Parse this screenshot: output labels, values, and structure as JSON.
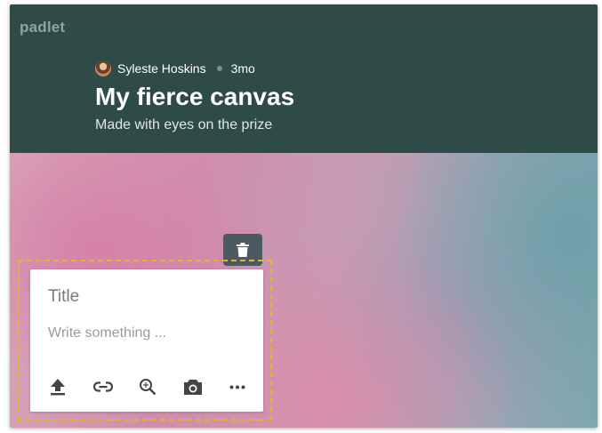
{
  "header": {
    "logo": "padlet",
    "author": "Syleste Hoskins",
    "age": "3mo",
    "title": "My fierce canvas",
    "subtitle": "Made with eyes on the prize"
  },
  "post_card": {
    "title_placeholder": "Title",
    "body_placeholder": "Write something ..."
  },
  "icons": {
    "trash": "trash-icon",
    "upload": "upload-icon",
    "link": "link-icon",
    "search": "image-search-icon",
    "camera": "camera-icon",
    "more": "more-icon"
  },
  "colors": {
    "header_bg": "#2f4b48",
    "selection_border": "#e6b526",
    "trash_button_bg": "#4b5a62",
    "icon_color": "#444444"
  }
}
